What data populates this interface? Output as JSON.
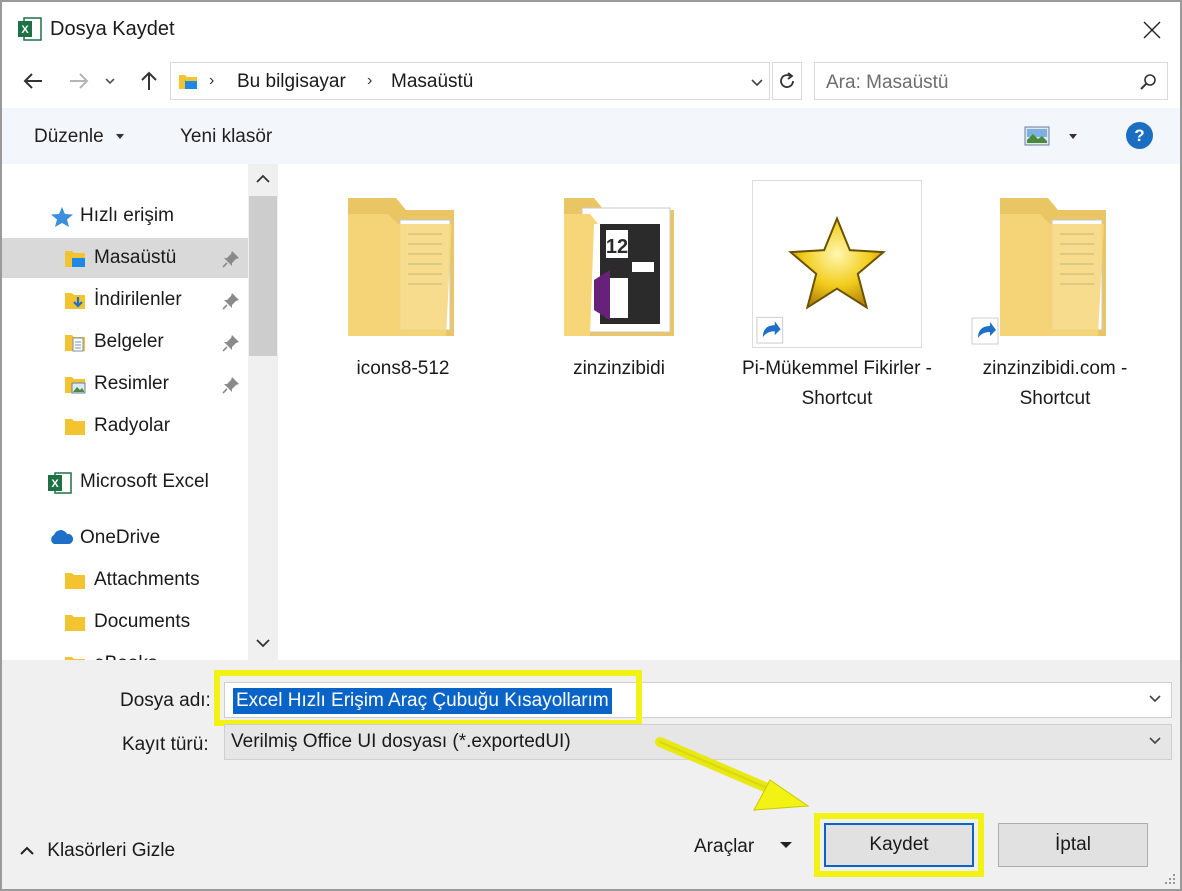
{
  "window": {
    "title": "Dosya Kaydet"
  },
  "nav": {
    "breadcrumbs": [
      "Bu bilgisayar",
      "Masaüstü"
    ],
    "search_placeholder": "Ara: Masaüstü"
  },
  "toolbar": {
    "organize": "Düzenle",
    "new_folder": "Yeni klasör",
    "help": "?"
  },
  "sidebar": {
    "items": [
      {
        "label": "Hızlı erişim",
        "icon": "star-icon"
      },
      {
        "label": "Masaüstü",
        "icon": "desktop-folder-icon",
        "pinned": true,
        "selected": true
      },
      {
        "label": "İndirilenler",
        "icon": "downloads-folder-icon",
        "pinned": true
      },
      {
        "label": "Belgeler",
        "icon": "documents-folder-icon",
        "pinned": true
      },
      {
        "label": "Resimler",
        "icon": "pictures-folder-icon",
        "pinned": true
      },
      {
        "label": "Radyolar",
        "icon": "folder-icon"
      },
      {
        "label": "Microsoft Excel",
        "icon": "excel-icon"
      },
      {
        "label": "OneDrive",
        "icon": "onedrive-cloud-icon"
      },
      {
        "label": "Attachments",
        "icon": "folder-icon"
      },
      {
        "label": "Documents",
        "icon": "folder-icon"
      },
      {
        "label": "eBooks",
        "icon": "folder-icon"
      }
    ]
  },
  "files": [
    {
      "name": "icons8-512",
      "icon": "folder-with-documents-icon"
    },
    {
      "name": "zinzinzibidi",
      "icon": "folder-with-visual-studio-icon"
    },
    {
      "name": "Pi-Mükemmel Fikirler - Shortcut",
      "icon": "star-shortcut-icon"
    },
    {
      "name": "zinzinzibidi.com - Shortcut",
      "icon": "folder-shortcut-icon"
    }
  ],
  "footer": {
    "filename_label": "Dosya adı:",
    "filename_value": "Excel Hızlı Erişim Araç Çubuğu Kısayollarım",
    "filetype_label": "Kayıt türü:",
    "filetype_value": "Verilmiş Office UI dosyası (*.exportedUI)",
    "hide_folders": "Klasörleri Gizle",
    "tools": "Araçlar",
    "save": "Kaydet",
    "cancel": "İptal"
  },
  "colors": {
    "highlight": "#f2f215",
    "selection": "#0a64c8",
    "accent": "#1b6ec2"
  }
}
